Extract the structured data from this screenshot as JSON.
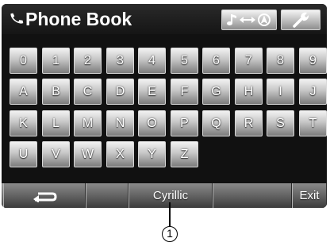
{
  "header": {
    "title": "Phone Book",
    "icon": "phone-handset-icon",
    "mode_button_icon": "music-to-navigation-icon",
    "settings_button_icon": "wrench-icon"
  },
  "keyboard": {
    "rows": [
      [
        "0",
        "1",
        "2",
        "3",
        "4",
        "5",
        "6",
        "7",
        "8",
        "9"
      ],
      [
        "A",
        "B",
        "C",
        "D",
        "E",
        "F",
        "G",
        "H",
        "I",
        "J"
      ],
      [
        "K",
        "L",
        "M",
        "N",
        "O",
        "P",
        "Q",
        "R",
        "S",
        "T"
      ],
      [
        "U",
        "V",
        "W",
        "X",
        "Y",
        "Z"
      ]
    ]
  },
  "bottom_bar": {
    "back_icon": "back-arrow-icon",
    "cyrillic_label": "Cyrillic",
    "exit_label": "Exit"
  },
  "callout": {
    "number": "1"
  }
}
